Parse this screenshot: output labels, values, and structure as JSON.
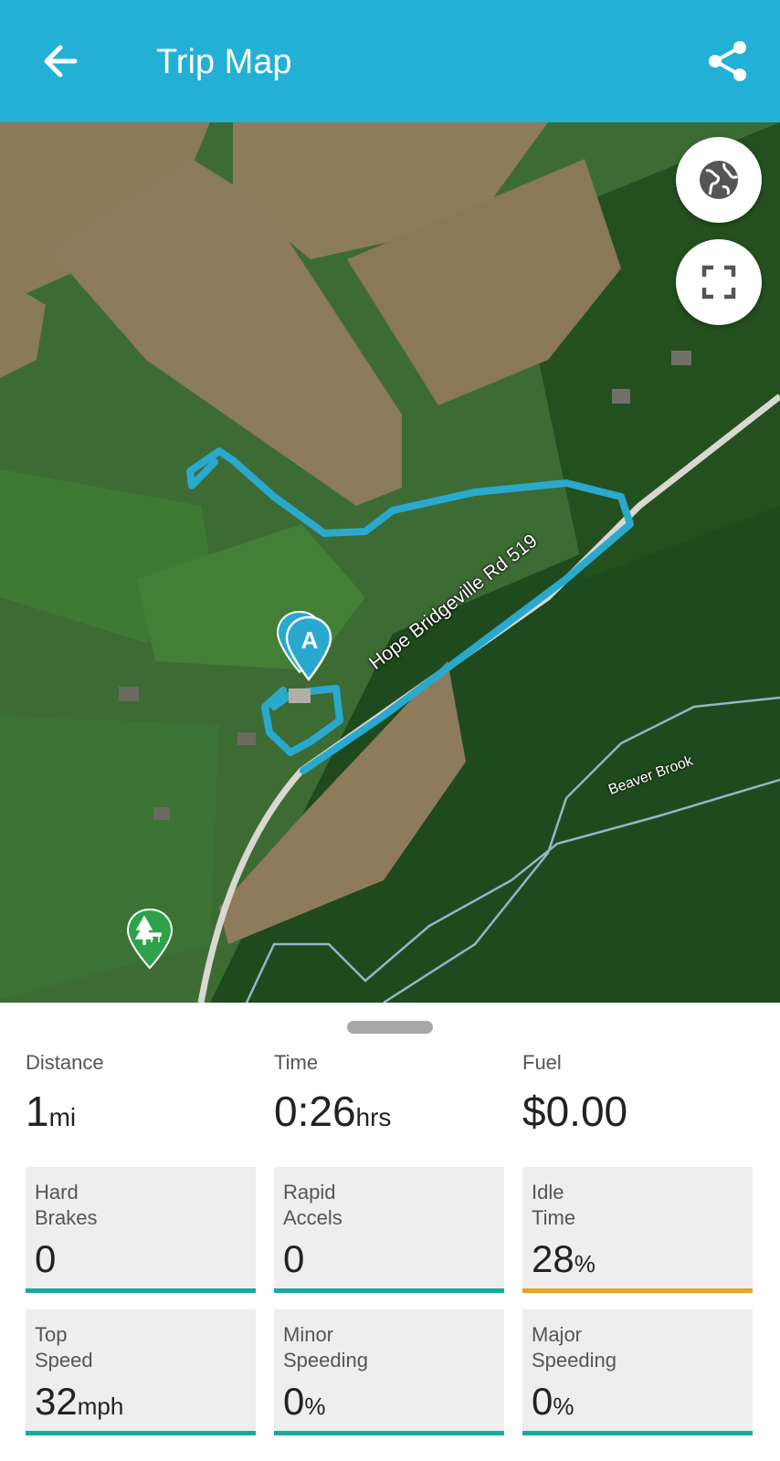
{
  "header": {
    "title": "Trip Map"
  },
  "map": {
    "road_label": "Hope Bridgeville Rd 519",
    "brook_label": "Beaver Brook",
    "start_marker_label": "A",
    "route_color": "#2aa9cf",
    "buttons": [
      "globe-icon",
      "fullscreen-icon"
    ]
  },
  "summary": {
    "distance": {
      "label": "Distance",
      "value": "1",
      "unit": "mi"
    },
    "time": {
      "label": "Time",
      "value": "0:26",
      "unit": "hrs"
    },
    "fuel": {
      "label": "Fuel",
      "value": "$0.00",
      "unit": ""
    }
  },
  "cards": [
    {
      "label": "Hard\nBrakes",
      "value": "0",
      "unit": "",
      "status_color": "#1aa89a"
    },
    {
      "label": "Rapid\nAccels",
      "value": "0",
      "unit": "",
      "status_color": "#1aa89a"
    },
    {
      "label": "Idle\nTime",
      "value": "28",
      "unit": "%",
      "status_color": "#e0a820"
    },
    {
      "label": "Top\nSpeed",
      "value": "32",
      "unit": "mph",
      "status_color": "#1aa89a"
    },
    {
      "label": "Minor\nSpeeding",
      "value": "0",
      "unit": "%",
      "status_color": "#1aa89a"
    },
    {
      "label": "Major\nSpeeding",
      "value": "0",
      "unit": "%",
      "status_color": "#1aa89a"
    }
  ]
}
